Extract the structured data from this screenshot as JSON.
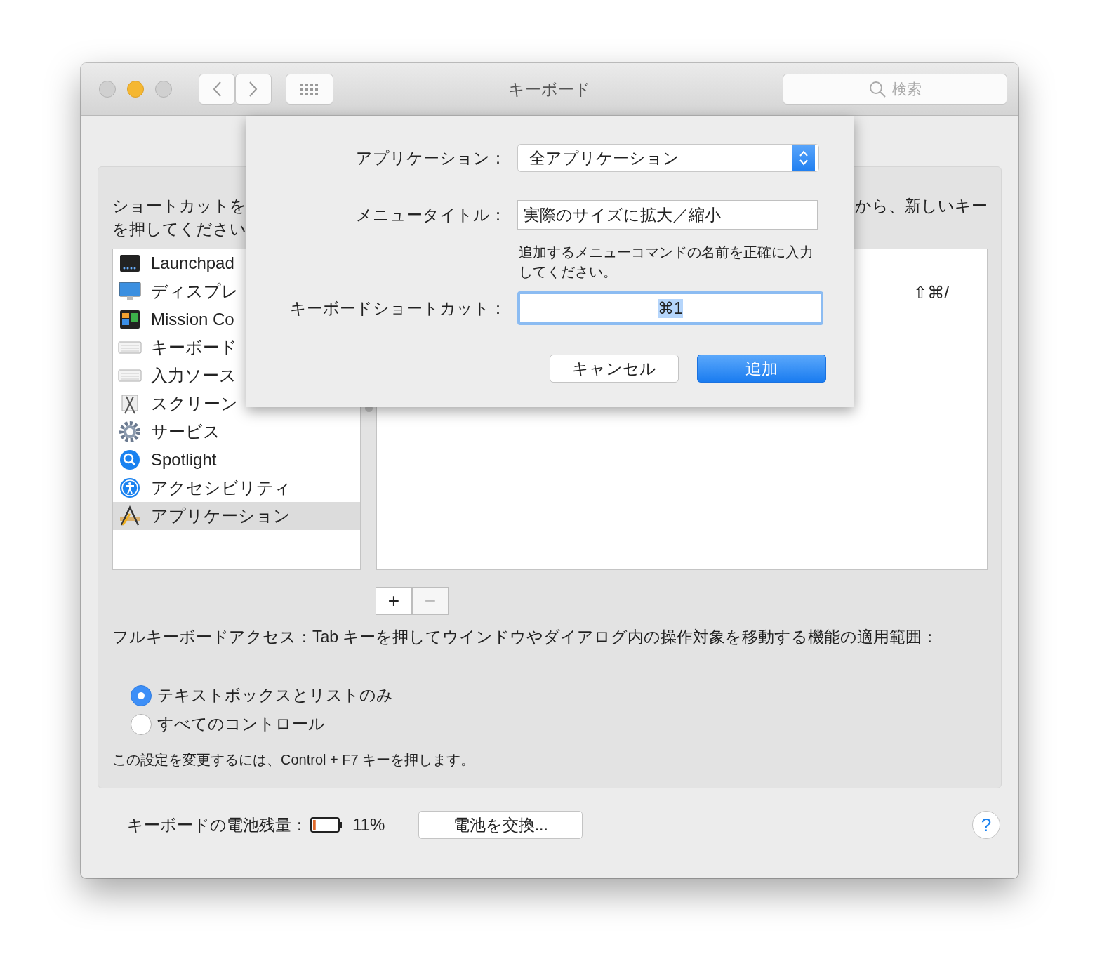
{
  "window": {
    "title": "キーボード",
    "traffic_lights": [
      {
        "enabled": false
      },
      {
        "enabled": true
      },
      {
        "enabled": false
      }
    ]
  },
  "search": {
    "placeholder": "検索"
  },
  "instruction": {
    "left_lines": [
      "ショートカットを",
      "を押してください"
    ],
    "right": "から、新しいキー"
  },
  "categories": [
    {
      "label": "Launchpad",
      "kind": "launchpad",
      "selected": false
    },
    {
      "label": "ディスプレ",
      "kind": "display",
      "selected": false
    },
    {
      "label": "Mission Co",
      "kind": "mission",
      "selected": false
    },
    {
      "label": "キーボード",
      "kind": "keyboard",
      "selected": false
    },
    {
      "label": "入力ソース",
      "kind": "keyboard",
      "selected": false
    },
    {
      "label": "スクリーン",
      "kind": "screenshot",
      "selected": false
    },
    {
      "label": "サービス",
      "kind": "gear",
      "selected": false
    },
    {
      "label": "Spotlight",
      "kind": "spotlight",
      "selected": false
    },
    {
      "label": "アクセシビリティ",
      "kind": "accessibility",
      "selected": false
    },
    {
      "label": "アプリケーション",
      "kind": "apps",
      "selected": true
    }
  ],
  "shortcuts": [
    {
      "keys": "⇧⌘/"
    }
  ],
  "list_buttons": [
    {
      "label": "+",
      "disabled": false
    },
    {
      "label": "−",
      "disabled": true
    }
  ],
  "full_keyboard_access": {
    "label": "フルキーボードアクセス：Tab キーを押してウインドウやダイアログ内の操作対象を移動する機能の適用範囲：",
    "options": [
      {
        "label": "テキストボックスとリストのみ",
        "selected": true
      },
      {
        "label": "すべてのコントロール",
        "selected": false
      }
    ],
    "hint": "この設定を変更するには、Control + F7 キーを押します。"
  },
  "battery": {
    "label": "キーボードの電池残量：",
    "level": 0.11,
    "reading": "11%",
    "button": "電池を交換..."
  },
  "help": "?",
  "sheet": {
    "application": {
      "label": "アプリケーション：",
      "value": "全アプリケーション"
    },
    "menu_title": {
      "label": "メニュータイトル：",
      "value": "実際のサイズに拡大／縮小",
      "hint": "追加するメニューコマンドの名前を正確に入力してください。"
    },
    "shortcut": {
      "label": "キーボードショートカット：",
      "value": "⌘1",
      "focused": true
    },
    "buttons": [
      {
        "label": "キャンセル",
        "default": false
      },
      {
        "label": "追加",
        "default": true
      }
    ]
  }
}
